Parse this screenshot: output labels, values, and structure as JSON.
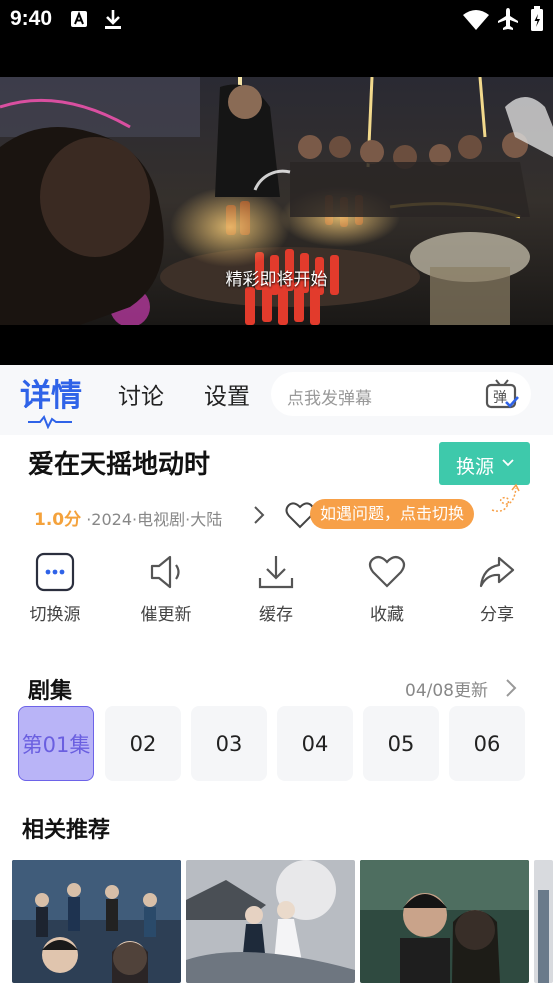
{
  "status_bar": {
    "time": "9:40"
  },
  "player": {
    "caption": "精彩即将开始"
  },
  "tabs": [
    {
      "label": "详情",
      "active": true
    },
    {
      "label": "讨论",
      "active": false
    },
    {
      "label": "设置",
      "active": false
    }
  ],
  "danmaku": {
    "placeholder": "点我发弹幕",
    "icon_label": "弹"
  },
  "detail": {
    "title": "爱在天摇地动时",
    "switch_source_label": "换源",
    "score": "1.0分",
    "meta": "·2024·电视剧·大陆",
    "tip": "如遇问题，点击切换"
  },
  "actions": [
    {
      "label": "切换源",
      "icon": "source-switch-icon"
    },
    {
      "label": "催更新",
      "icon": "speaker-icon"
    },
    {
      "label": "缓存",
      "icon": "download-icon"
    },
    {
      "label": "收藏",
      "icon": "heart-icon"
    },
    {
      "label": "分享",
      "icon": "share-icon"
    }
  ],
  "episodes": {
    "title": "剧集",
    "update_text": "04/08更新",
    "items": [
      "第01集",
      "02",
      "03",
      "04",
      "05",
      "06"
    ]
  },
  "related": {
    "title": "相关推荐"
  },
  "colors": {
    "accent": "#2f63e8",
    "source_button": "#3ec9ab",
    "score": "#f4a23c",
    "tip": "#f7a048",
    "active_episode": "#b9b4f7"
  }
}
